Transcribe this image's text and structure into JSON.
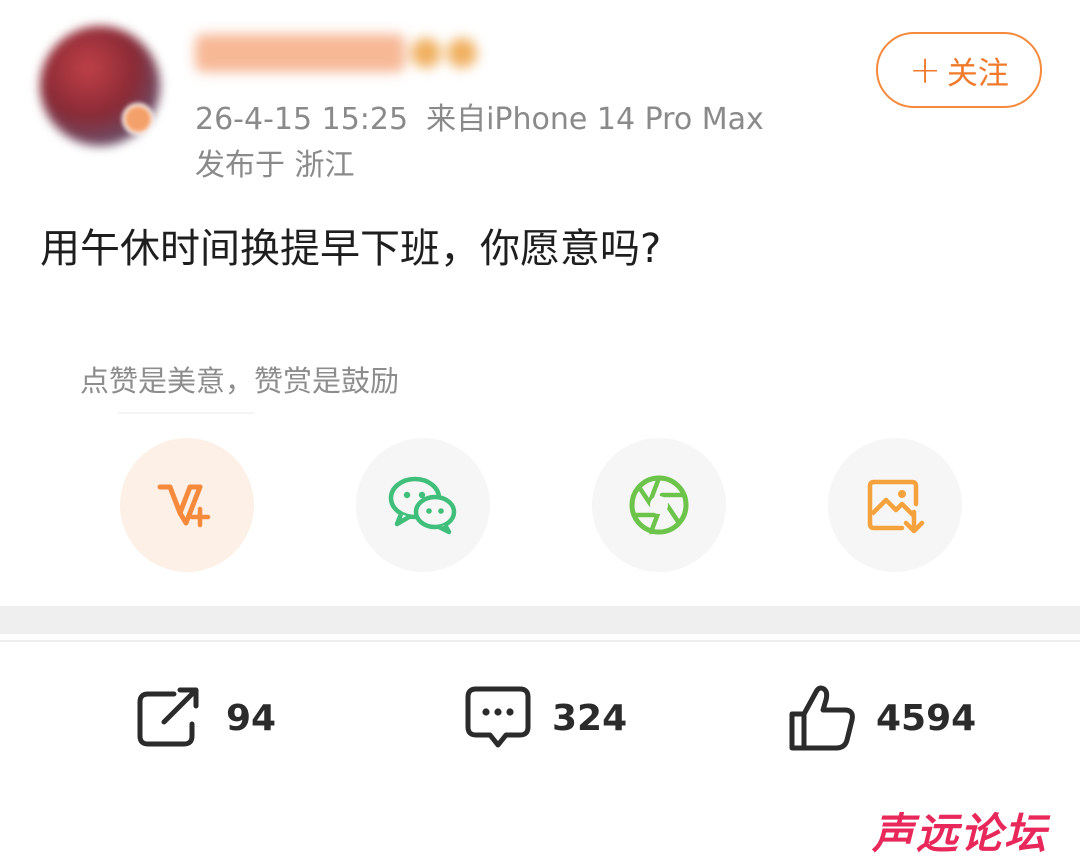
{
  "post": {
    "username": "",
    "timestamp": "26-4-15 15:25",
    "source": "来自iPhone 14 Pro Max",
    "location": "发布于 浙江",
    "follow_plus": "+",
    "follow_label": "关注",
    "text": "用午休时间换提早下班，你愿意吗?"
  },
  "reward": {
    "hint": "点赞是美意，赞赏是鼓励"
  },
  "share_targets": [
    {
      "icon": "v-plus-reward-icon",
      "color": "#f58a3c"
    },
    {
      "icon": "wechat-icon",
      "color": "#3fbf7a"
    },
    {
      "icon": "moments-aperture-icon",
      "color": "#6cc54a"
    },
    {
      "icon": "save-image-icon",
      "color": "#f5a23c"
    }
  ],
  "actions": {
    "repost_count": "94",
    "comment_count": "324",
    "like_count": "4594"
  },
  "watermark": {
    "text": "声远论坛",
    "color": "#e8285a"
  },
  "colors": {
    "accent": "#f07a2a",
    "meta_text": "#8a8a8a"
  }
}
